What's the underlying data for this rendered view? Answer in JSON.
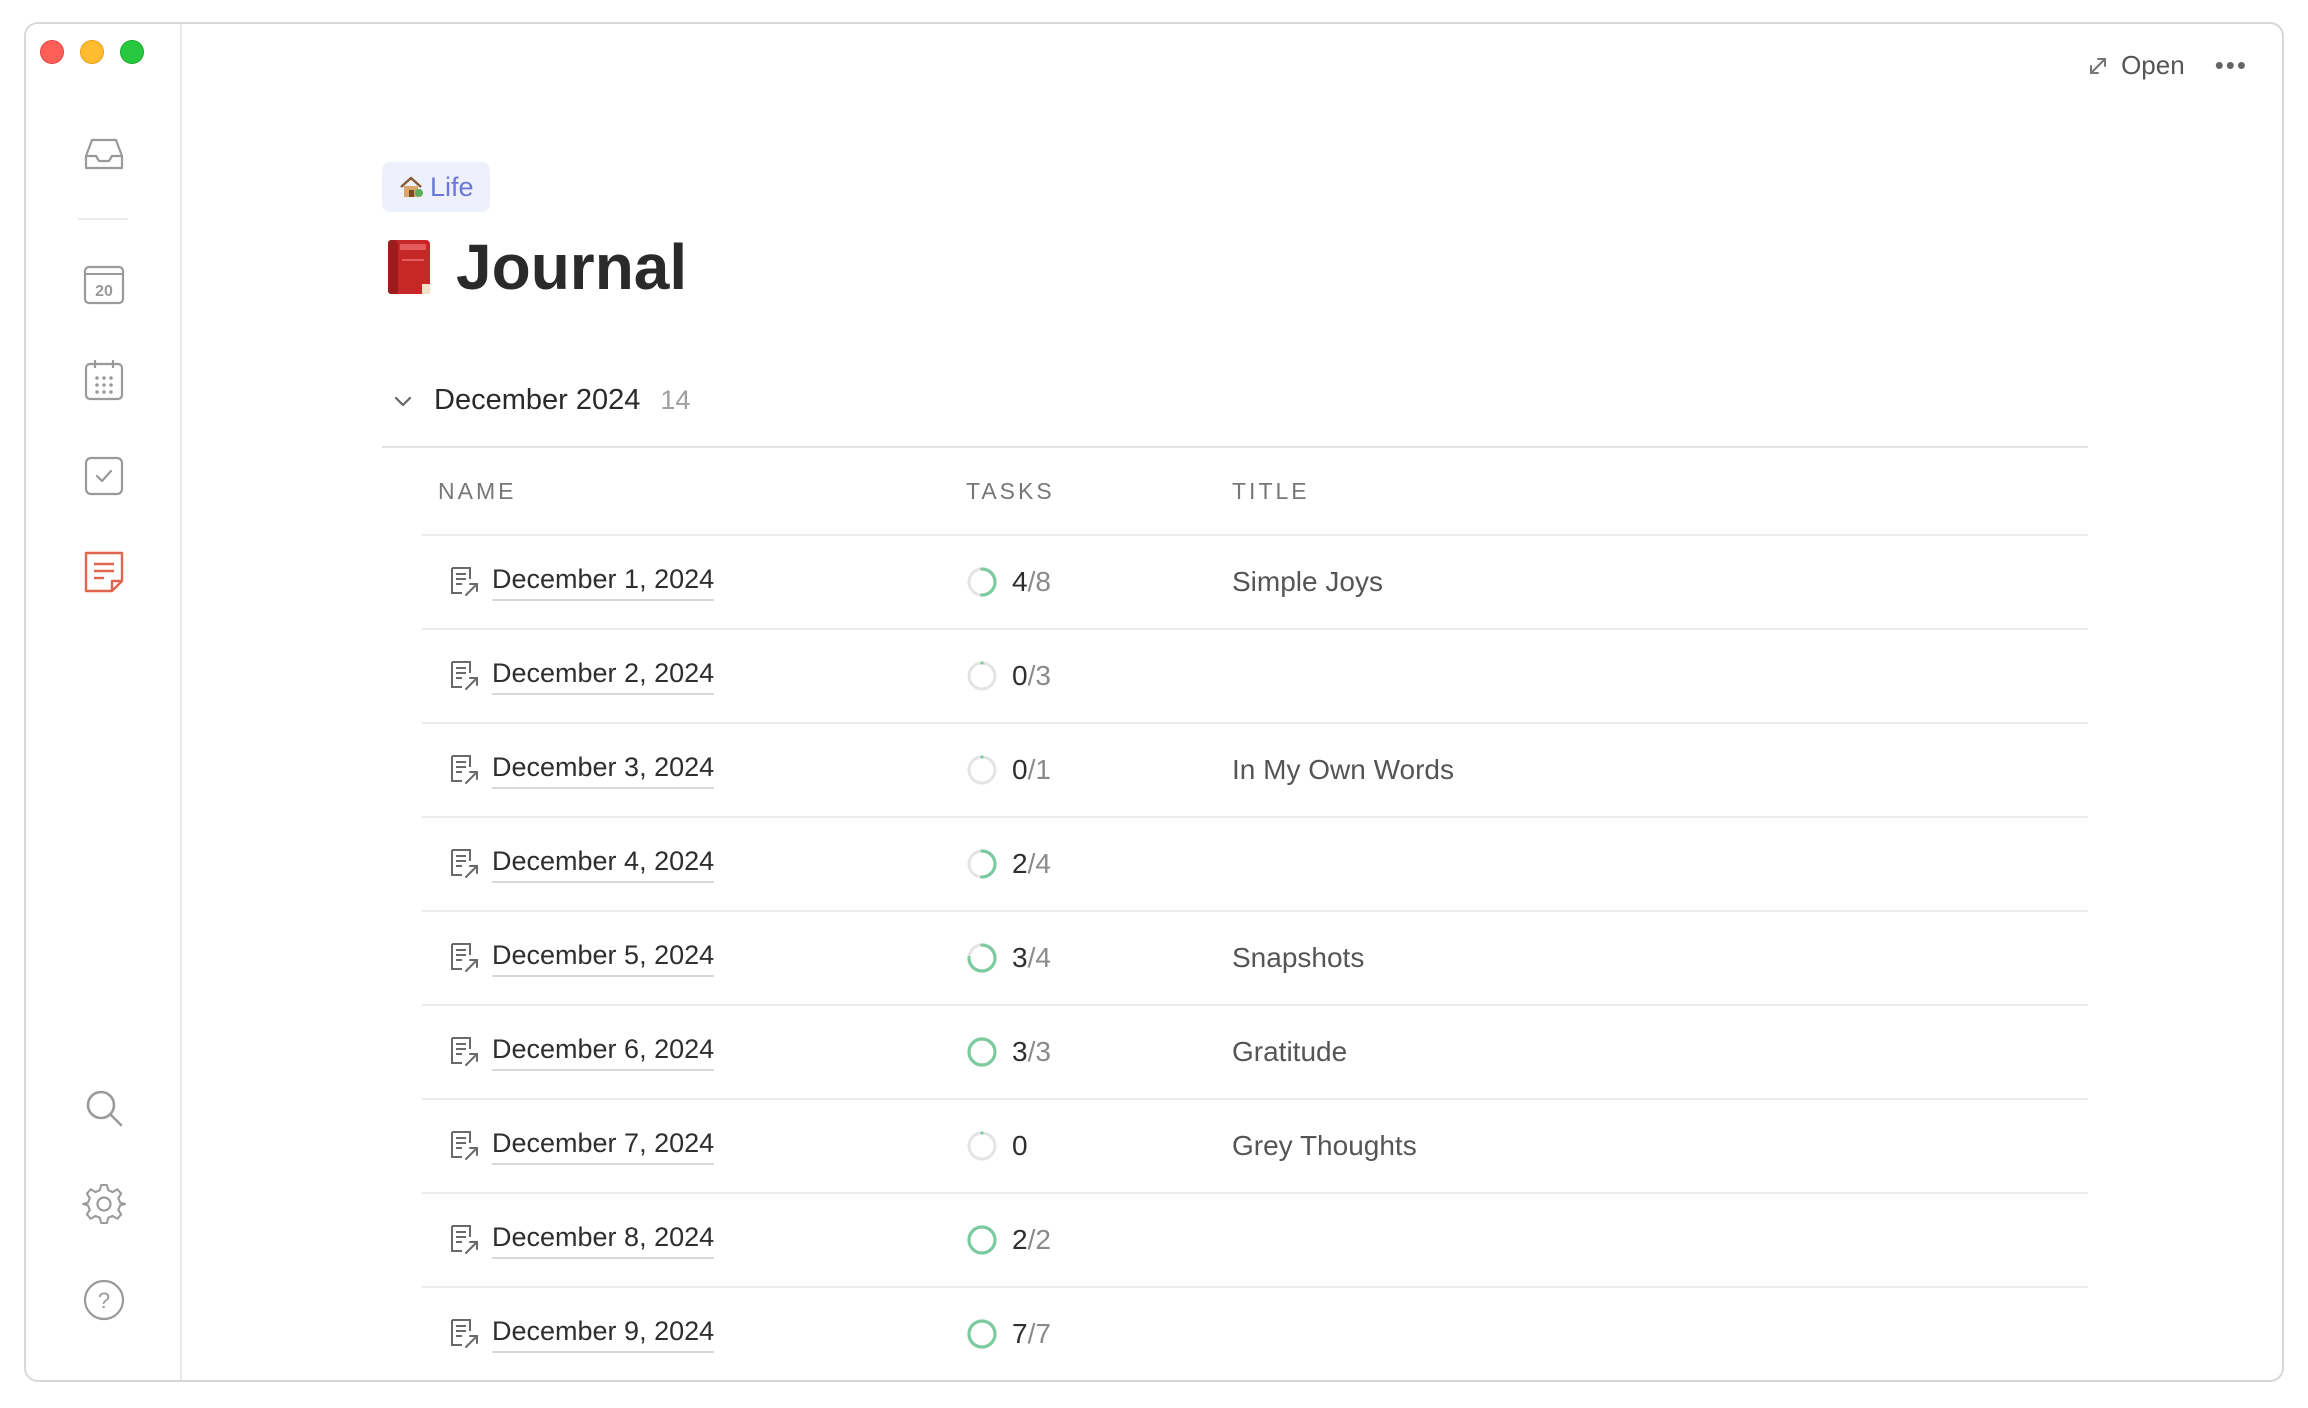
{
  "page": {
    "tag_label": "Life",
    "title": "Journal",
    "open_label": "Open",
    "more_label": "•••"
  },
  "group": {
    "title": "December 2024",
    "count": "14"
  },
  "table": {
    "headers": {
      "name": "NAME",
      "tasks": "TASKS",
      "title": "TITLE"
    },
    "rows": [
      {
        "name": "December 1, 2024",
        "done": "4",
        "total": "/8",
        "progress": 0.5,
        "title": "Simple Joys"
      },
      {
        "name": "December 2, 2024",
        "done": "0",
        "total": "/3",
        "progress": 0,
        "title": ""
      },
      {
        "name": "December 3, 2024",
        "done": "0",
        "total": "/1",
        "progress": 0,
        "title": "In My Own Words"
      },
      {
        "name": "December 4, 2024",
        "done": "2",
        "total": "/4",
        "progress": 0.5,
        "title": ""
      },
      {
        "name": "December 5, 2024",
        "done": "3",
        "total": "/4",
        "progress": 0.75,
        "title": "Snapshots"
      },
      {
        "name": "December 6, 2024",
        "done": "3",
        "total": "/3",
        "progress": 1,
        "title": "Gratitude"
      },
      {
        "name": "December 7, 2024",
        "done": "0",
        "total": "",
        "progress": 0,
        "title": "Grey Thoughts"
      },
      {
        "name": "December 8, 2024",
        "done": "2",
        "total": "/2",
        "progress": 1,
        "title": ""
      },
      {
        "name": "December 9, 2024",
        "done": "7",
        "total": "/7",
        "progress": 1,
        "title": ""
      }
    ]
  },
  "sidebar": {
    "calendar_day": "20",
    "icons": [
      "inbox-icon",
      "today-calendar-icon",
      "month-calendar-icon",
      "tasks-checkbox-icon",
      "journal-notes-icon",
      "search-icon",
      "settings-gear-icon",
      "help-icon"
    ]
  },
  "colors": {
    "progress_green": "#7ccaa0",
    "progress_track": "#e4e4e4",
    "tag_bg": "#eef0fb",
    "tag_text": "#6b78d6",
    "journal_active": "#e0654f"
  }
}
